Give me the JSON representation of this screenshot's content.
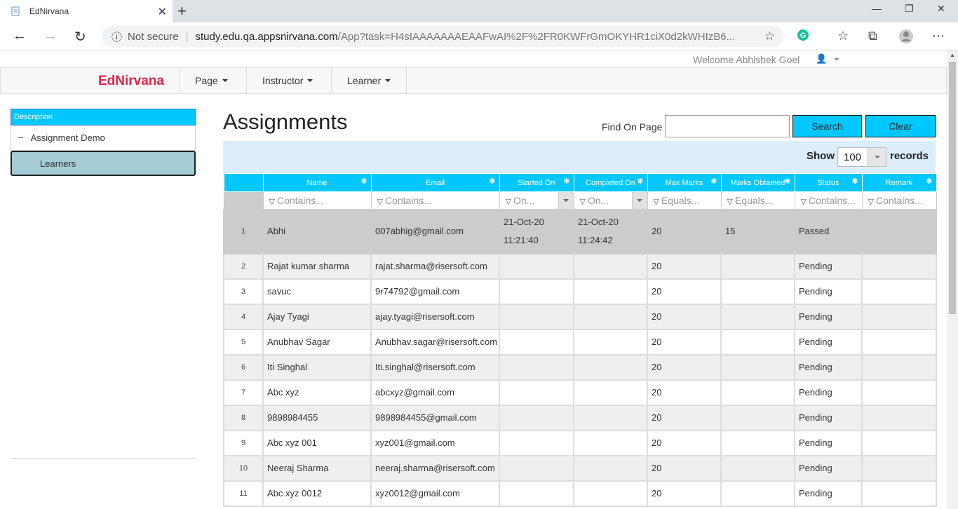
{
  "browser": {
    "tab_title": "EdNirvana",
    "not_secure": "Not secure",
    "url_host": "study.edu.qa.appsnirvana.com",
    "url_path": "/App?task=H4sIAAAAAAAEAAFwAI%2F%2FR0KWFrGmOKYHR1ciX0d2kWHIzB6..."
  },
  "header": {
    "welcome": "Welcome Abhishek Goel",
    "brand": "EdNirvana",
    "menu": [
      "Page",
      "Instructor",
      "Learner"
    ]
  },
  "sidebar": {
    "heading": "Description",
    "item": "Assignment Demo",
    "sub_item": "Learners"
  },
  "main": {
    "title": "Assignments",
    "find_label": "Find On Page",
    "find_value": "",
    "search_label": "Search",
    "clear_label": "Clear",
    "show_label": "Show",
    "show_value": "100",
    "records_label": "records"
  },
  "grid": {
    "columns": [
      "Name",
      "Email",
      "Started On",
      "Completed On",
      "Max Marks",
      "Marks Obtained",
      "Status",
      "Remark"
    ],
    "filters": [
      "Contains...",
      "Contains...",
      "On...",
      "On...",
      "Equals...",
      "Equals...",
      "Contains...",
      "Contains..."
    ],
    "rows": [
      {
        "n": "1",
        "name": "Abhi",
        "email": "007abhig@gmail.com",
        "started_date": "21-Oct-20",
        "started_time": "11:21:40",
        "completed_date": "21-Oct-20",
        "completed_time": "11:24:42",
        "max": "20",
        "obtained": "15",
        "status": "Passed",
        "remark": ""
      },
      {
        "n": "2",
        "name": "Rajat kumar sharma",
        "email": "rajat.sharma@risersoft.com",
        "max": "20",
        "obtained": "",
        "status": "Pending",
        "remark": ""
      },
      {
        "n": "3",
        "name": "savuc",
        "email": "9r74792@gmail.com",
        "max": "20",
        "obtained": "",
        "status": "Pending",
        "remark": ""
      },
      {
        "n": "4",
        "name": "Ajay Tyagi",
        "email": "ajay.tyagi@risersoft.com",
        "max": "20",
        "obtained": "",
        "status": "Pending",
        "remark": ""
      },
      {
        "n": "5",
        "name": "Anubhav Sagar",
        "email": "Anubhav.sagar@risersoft.com",
        "max": "20",
        "obtained": "",
        "status": "Pending",
        "remark": ""
      },
      {
        "n": "6",
        "name": "Iti Singhal",
        "email": "Iti.singhal@risersoft.com",
        "max": "20",
        "obtained": "",
        "status": "Pending",
        "remark": ""
      },
      {
        "n": "7",
        "name": "Abc xyz",
        "email": "abcxyz@gmail.com",
        "max": "20",
        "obtained": "",
        "status": "Pending",
        "remark": ""
      },
      {
        "n": "8",
        "name": "9898984455",
        "email": "9898984455@gmail.com",
        "max": "20",
        "obtained": "",
        "status": "Pending",
        "remark": ""
      },
      {
        "n": "9",
        "name": "Abc xyz 001",
        "email": "xyz001@gmail.com",
        "max": "20",
        "obtained": "",
        "status": "Pending",
        "remark": ""
      },
      {
        "n": "10",
        "name": "Neeraj Sharma",
        "email": "neeraj.sharma@risersoft.com",
        "max": "20",
        "obtained": "",
        "status": "Pending",
        "remark": ""
      },
      {
        "n": "11",
        "name": "Abc xyz 0012",
        "email": "xyz0012@gmail.com",
        "max": "20",
        "obtained": "",
        "status": "Pending",
        "remark": ""
      }
    ]
  }
}
